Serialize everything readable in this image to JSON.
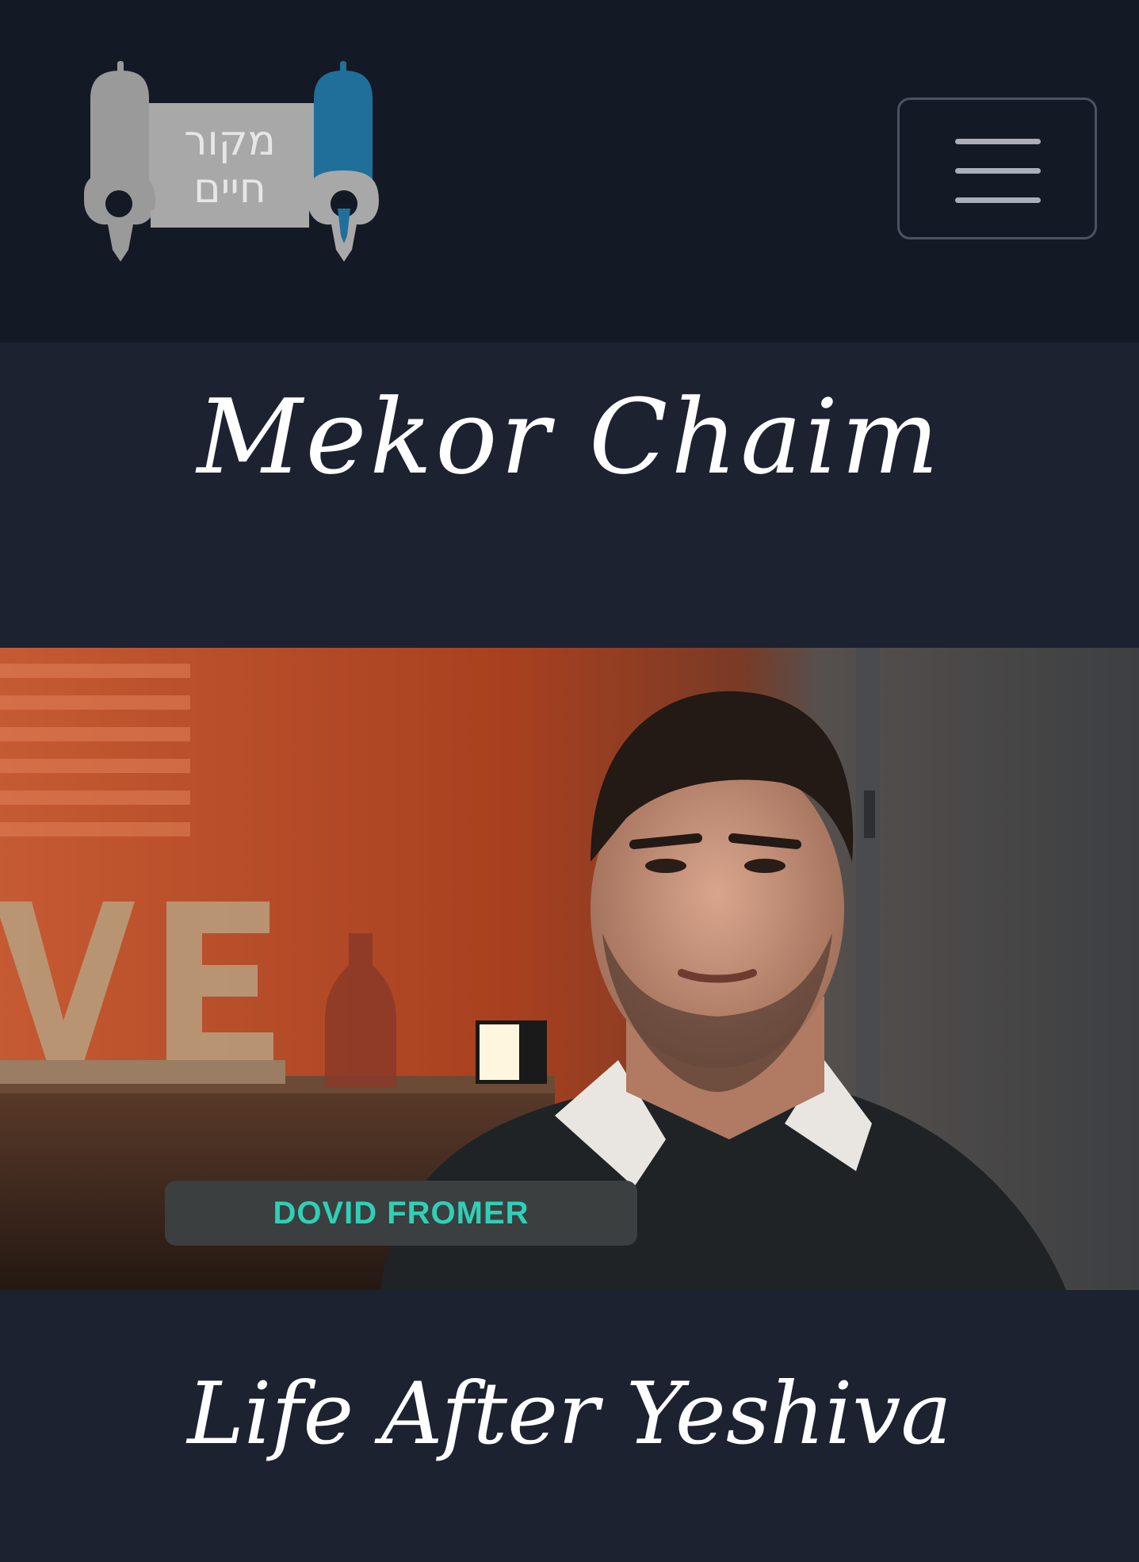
{
  "header": {
    "logo": {
      "icon": "torah-scroll-logo-icon",
      "line1": "מקור",
      "line2": "חיים",
      "color_gray": "#9a9a9a",
      "color_blue": "#1f6f9a"
    },
    "menu_icon": "hamburger-menu-icon"
  },
  "site": {
    "title": "Mekor Chaim"
  },
  "featured": {
    "video_name_tag": "DOVID FROMER",
    "title": "Life After Yeshiva"
  },
  "colors": {
    "header_bg": "#141a25",
    "page_bg": "#1c2230",
    "name_tag_text": "#2fd0b5"
  }
}
